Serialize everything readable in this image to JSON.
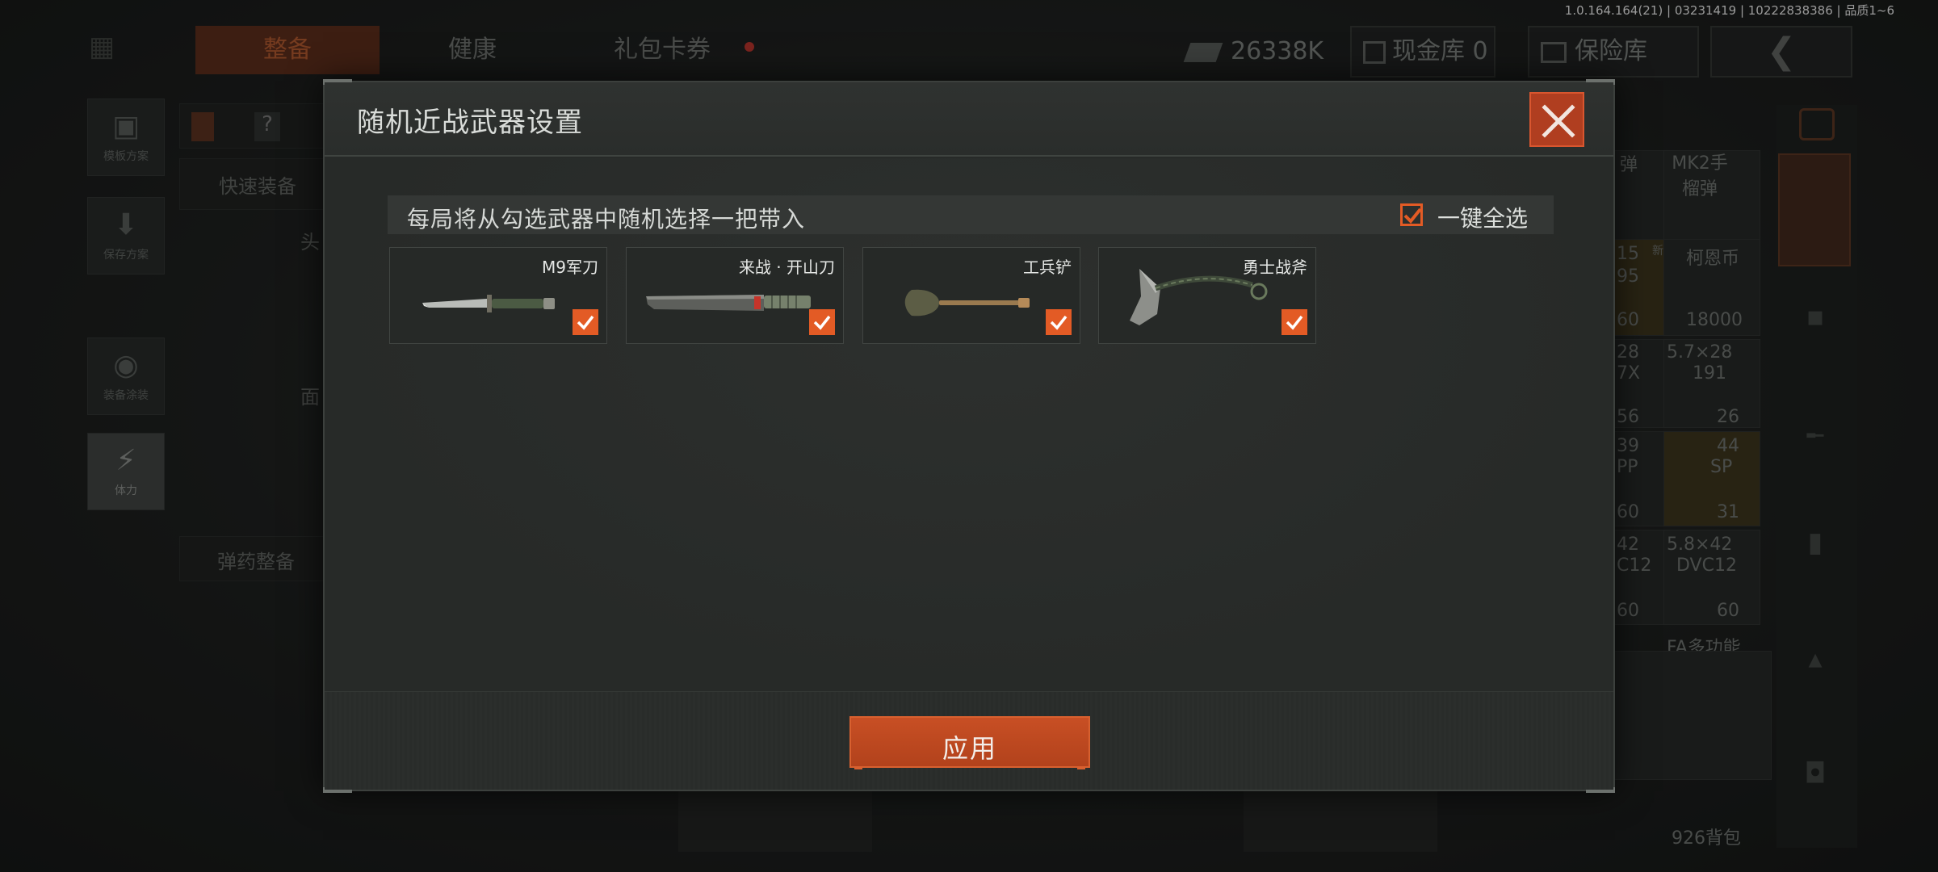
{
  "version": "1.0.164.164(21) | 03231419 | 10222838386 | 品质1~6",
  "background": {
    "tabs": [
      "整备",
      "健康",
      "礼包卡券"
    ],
    "currency": "26338K",
    "cash_vault": "现金库 0",
    "insurance": "保险库",
    "left_buttons": [
      "模板方案",
      "保存方案",
      "装备涂装",
      "体力"
    ],
    "panel_labels": [
      "快速装备",
      "头",
      "面",
      "弹药整备"
    ],
    "grid_top_labels": [
      "弹",
      "MK2手榴弹"
    ],
    "grid_values": [
      "15",
      "95",
      "60",
      "18000",
      "28",
      "7X",
      "5.7×28",
      "191",
      "56",
      "26",
      "39",
      "PP",
      "44",
      "SP",
      "60",
      "31",
      "42",
      "C12",
      "5.8×42",
      "DVC12",
      "60",
      "60"
    ],
    "grid_item_labels": [
      "柯恩币",
      "新"
    ],
    "grid_bottom_label": "FA多功能",
    "bottom_label": "926背包"
  },
  "modal": {
    "title": "随机近战武器设置",
    "info_text": "每局将从勾选武器中随机选择一把带入",
    "select_all_label": "一键全选",
    "select_all_checked": true,
    "weapons": [
      {
        "name": "M9军刀",
        "checked": true,
        "icon": "combat-knife"
      },
      {
        "name": "来战 · 开山刀",
        "checked": true,
        "icon": "machete"
      },
      {
        "name": "工兵铲",
        "checked": true,
        "icon": "entrenching-shovel"
      },
      {
        "name": "勇士战斧",
        "checked": true,
        "icon": "tomahawk-axe"
      }
    ],
    "apply_label": "应用"
  },
  "colors": {
    "accent": "#e35b25",
    "close_bg": "#b03e20",
    "apply_bg": "#c84f24",
    "modal_bg": "#272a28"
  }
}
